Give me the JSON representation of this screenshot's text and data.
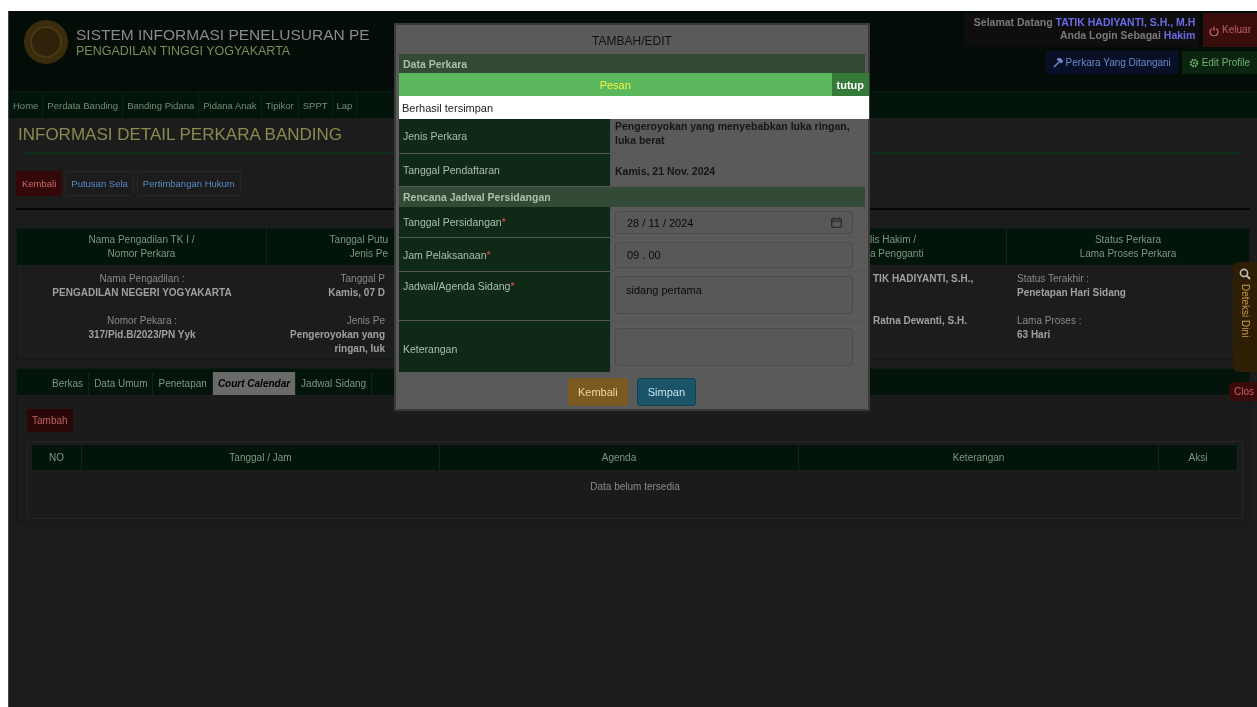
{
  "header": {
    "title": "SISTEM INFORMASI PENELUSURAN PE",
    "subtitle": "PENGADILAN TINGGI YOGYAKARTA",
    "greeting": "Selamat Datang",
    "user_name": "TATIK HADIYANTI, S.H., M.H",
    "role_prefix": "Anda Login Sebagai",
    "role": "Hakim",
    "logout": "Keluar",
    "buttons": [
      {
        "label": "Perkara Yang Ditangani",
        "kind": "cases"
      },
      {
        "label": "Edit Profile",
        "kind": "profile"
      }
    ]
  },
  "nav": [
    {
      "label": "Home"
    },
    {
      "label": "Perdata Banding"
    },
    {
      "label": "Banding Pidana"
    },
    {
      "label": "Pidana Anak"
    },
    {
      "label": "Tipikor"
    },
    {
      "label": "SPPT"
    },
    {
      "label": "Lap"
    }
  ],
  "page_title": "INFORMASI DETAIL PERKARA BANDING",
  "actions": [
    {
      "label": "Kembali",
      "kind": "danger"
    },
    {
      "label": "Putusan Sela",
      "kind": "plain"
    },
    {
      "label": "Pertimbangan Hukum",
      "kind": "plain"
    }
  ],
  "summary": {
    "columns": [
      {
        "kind": "centered",
        "lines": [
          "Nama Pengadilan TK I /",
          "Nomor Perkara"
        ],
        "cells": [
          {
            "kind": "label",
            "text": "Nama Pengadilan :"
          },
          {
            "kind": "value",
            "text": "PENGADILAN NEGERI YOGYAKARTA"
          },
          {
            "kind": "gap"
          },
          {
            "kind": "label",
            "text": "Nomor Pekara :"
          },
          {
            "kind": "value",
            "text": "317/Pid.B/2023/PN Yyk"
          }
        ]
      },
      {
        "kind": "cut_right",
        "lines": [
          "Tanggal Putu",
          "Jenis Pe"
        ],
        "cells": [
          {
            "kind": "label",
            "text": "Tanggal P"
          },
          {
            "kind": "value",
            "text": "Kamis, 07 D"
          },
          {
            "kind": "gap"
          },
          {
            "kind": "label",
            "text": "Jenis Pe"
          },
          {
            "kind": "value",
            "text": "Pengeroyokan yang"
          },
          {
            "kind": "value",
            "text": "ringan, luk"
          }
        ]
      },
      {
        "kind": "hidden"
      },
      {
        "kind": "cut_left",
        "lines": [
          "lis Hakim /",
          "a Pengganti"
        ],
        "cells": [
          {
            "kind": "value",
            "text": "TIK HADIYANTI, S.H.,"
          },
          {
            "kind": "gap"
          },
          {
            "kind": "gap"
          },
          {
            "kind": "value",
            "text": "Ratna Dewanti, S.H."
          }
        ]
      },
      {
        "kind": "left",
        "lines": [
          "Status Perkara",
          "Lama Proses Perkara"
        ],
        "cells": [
          {
            "kind": "label",
            "text": "Status Terakhir :"
          },
          {
            "kind": "value",
            "text": "Penetapan Hari Sidang"
          },
          {
            "kind": "gap"
          },
          {
            "kind": "label",
            "text": "Lama Proses :"
          },
          {
            "kind": "value",
            "text": "63 Hari"
          }
        ]
      }
    ]
  },
  "tabs": [
    {
      "label": "Berkas",
      "selected": false
    },
    {
      "label": "Data Umum",
      "selected": false
    },
    {
      "label": "Penetapan",
      "selected": false
    },
    {
      "label": "Court Calendar",
      "selected": true
    },
    {
      "label": "Jadwal Sidang",
      "selected": false
    }
  ],
  "add_button": "Tambah",
  "table": {
    "columns": [
      "NO",
      "Tanggal / Jam",
      "Agenda",
      "Keterangan",
      "Aksi"
    ],
    "empty_text": "Data belum tersedia"
  },
  "side_widget": {
    "label": "Deteksi Dini",
    "close": "Clos"
  },
  "dialog": {
    "title": "TAMBAH/EDIT",
    "sections": [
      {
        "heading": "Data Perkara",
        "rows": [
          {
            "kind": "text",
            "label": "Jenis Perkara",
            "value": "Pengeroyokan yang menyebabkan luka ringan, luka berat"
          },
          {
            "kind": "text",
            "label": "Tanggal Pendaftaran",
            "value": "Kamis, 21 Nov. 2024"
          }
        ]
      },
      {
        "heading": "Rencana Jadwal Persidangan",
        "rows": [
          {
            "kind": "date",
            "label": "Tanggal Persidangan",
            "required_mark": "*",
            "value": "28 / 11 / 2024"
          },
          {
            "kind": "time",
            "label": "Jam Pelaksanaan",
            "required_mark": "*",
            "value": "09 . 00"
          },
          {
            "kind": "textarea",
            "label": "Jadwal/Agenda Sidang",
            "required_mark": "*",
            "value": "sidang pertama"
          },
          {
            "kind": "textarea",
            "label": "Keterangan"
          }
        ]
      }
    ],
    "buttons": [
      {
        "label": "Kembali",
        "kind": "warning"
      },
      {
        "label": "Simpan",
        "kind": "primary"
      }
    ]
  },
  "toast": {
    "title": "Pesan",
    "close": "tutup",
    "message": "Berhasil tersimpan"
  }
}
